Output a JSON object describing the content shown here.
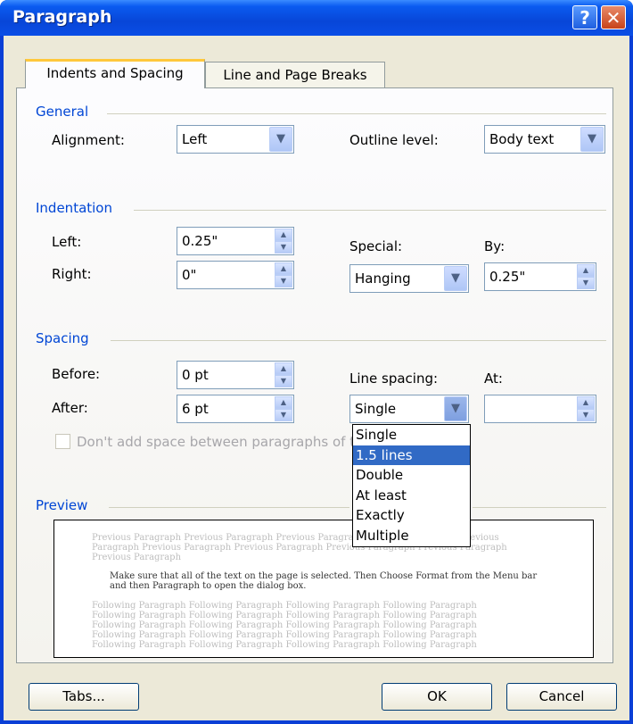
{
  "window": {
    "title": "Paragraph",
    "help_glyph": "?",
    "close_glyph": "✕"
  },
  "tabs": [
    {
      "label": "Indents and Spacing",
      "active": true
    },
    {
      "label": "Line and Page Breaks",
      "active": false
    }
  ],
  "general": {
    "heading": "General",
    "alignment_label": "Alignment:",
    "alignment_value": "Left",
    "outline_label": "Outline level:",
    "outline_value": "Body text"
  },
  "indentation": {
    "heading": "Indentation",
    "left_label": "Left:",
    "left_value": "0.25\"",
    "right_label": "Right:",
    "right_value": "0\"",
    "special_label": "Special:",
    "special_value": "Hanging",
    "by_label": "By:",
    "by_value": "0.25\""
  },
  "spacing": {
    "heading": "Spacing",
    "before_label": "Before:",
    "before_value": "0 pt",
    "after_label": "After:",
    "after_value": "6 pt",
    "line_spacing_label": "Line spacing:",
    "line_spacing_value": "Single",
    "at_label": "At:",
    "at_value": "",
    "checkbox_label": "Don't add space between paragraphs of the same style",
    "options": [
      "Single",
      "1.5 lines",
      "Double",
      "At least",
      "Exactly",
      "Multiple"
    ],
    "highlighted_option": "1.5 lines"
  },
  "preview": {
    "heading": "Preview",
    "previous_text": "Previous Paragraph Previous Paragraph Previous Paragraph Previous Paragraph Previous Paragraph Previous Paragraph Previous Paragraph Previous Paragraph Previous Paragraph Previous Paragraph",
    "current_text": "Make sure that all of the text on the page is selected. Then Choose Format from the Menu bar and then Paragraph to open the dialog box.",
    "following_text": "Following Paragraph Following Paragraph Following Paragraph Following Paragraph Following Paragraph Following Paragraph Following Paragraph Following Paragraph Following Paragraph Following Paragraph Following Paragraph Following Paragraph Following Paragraph Following Paragraph Following Paragraph Following Paragraph Following Paragraph Following Paragraph Following Paragraph Following Paragraph"
  },
  "buttons": {
    "tabs": "Tabs...",
    "ok": "OK",
    "cancel": "Cancel"
  }
}
